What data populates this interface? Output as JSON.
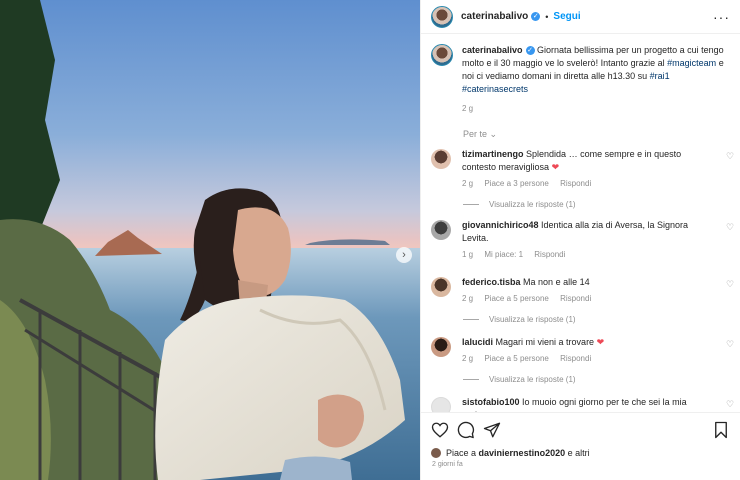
{
  "post": {
    "username": "caterinabalivo",
    "follow_label": "Segui",
    "more_icon": "more-options-icon",
    "caption_text": "Giornata bellissima per un progetto a cui tengo molto e il 30 maggio ve lo svelerò! Intanto grazie al",
    "hashtag_magicteam": "#magicteam",
    "caption_text_2": "e noi ci vediamo domani in diretta alle h13.30 su",
    "hashtag_rai1": "#rai1",
    "hashtag_caterinasecrets": "#caterinasecrets",
    "caption_age": "2 g"
  },
  "sort_label": "Per te",
  "comments": [
    {
      "user": "tizimartinengo",
      "text": "Splendida … come sempre e in questo contesto meravigliosa",
      "emoji": "❤",
      "age": "2 g",
      "likes": "Piace a 3 persone",
      "reply": "Rispondi",
      "view_replies": "Visualizza le risposte (1)"
    },
    {
      "user": "giovannichirico48",
      "text": "Identica alla zia di Aversa, la Signora Levita.",
      "age": "1 g",
      "likes": "Mi piace: 1",
      "reply": "Rispondi"
    },
    {
      "user": "federico.tisba",
      "text": "Ma non e alle 14",
      "age": "2 g",
      "likes": "Piace a 5 persone",
      "reply": "Rispondi",
      "view_replies": "Visualizza le risposte (1)"
    },
    {
      "user": "lalucidi",
      "text": "Magari mi vieni a trovare",
      "emoji": "❤",
      "age": "2 g",
      "likes": "Piace a 5 persone",
      "reply": "Rispondi",
      "view_replies": "Visualizza le risposte (1)"
    },
    {
      "user": "sistofabio100",
      "text": "Io muoio ogni giorno per te che sei la mia",
      "text_cut": "ragione"
    }
  ],
  "actions": {
    "likes_prefix": "Piace a",
    "likes_user": "daviniernestino2020",
    "likes_suffix": "e altri",
    "posted_ago": "2 giorni fa"
  },
  "colors": {
    "link": "#0095f6",
    "hashtag": "#00376b",
    "heart": "#ed4956",
    "verified": "#3897f0"
  }
}
